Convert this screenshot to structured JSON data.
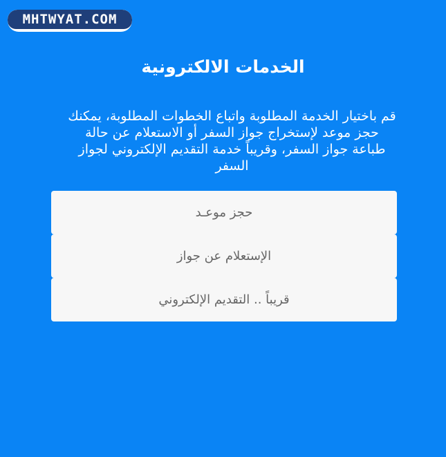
{
  "brand": {
    "logo_text": "MHTWYAT.COM"
  },
  "page": {
    "title": "الخدمات الالكترونية",
    "intro": "قم باختيار الخدمة المطلوبة واتباع الخطوات المطلوبة، يمكنك حجز موعد لإستخراج جواز السفر أو الاستعلام عن حالة طباعة جواز السفر، وقريباً خدمة التقديم الإلكتروني لجواز السفر"
  },
  "services": [
    {
      "label": "حجز موعـد"
    },
    {
      "label": "الإستعلام عن جواز"
    },
    {
      "label": "قريباً .. التقديم الإلكتروني"
    }
  ],
  "colors": {
    "background": "#0a84f5",
    "button_background": "#f7f7f7",
    "logo_background": "#1f3f7a"
  }
}
